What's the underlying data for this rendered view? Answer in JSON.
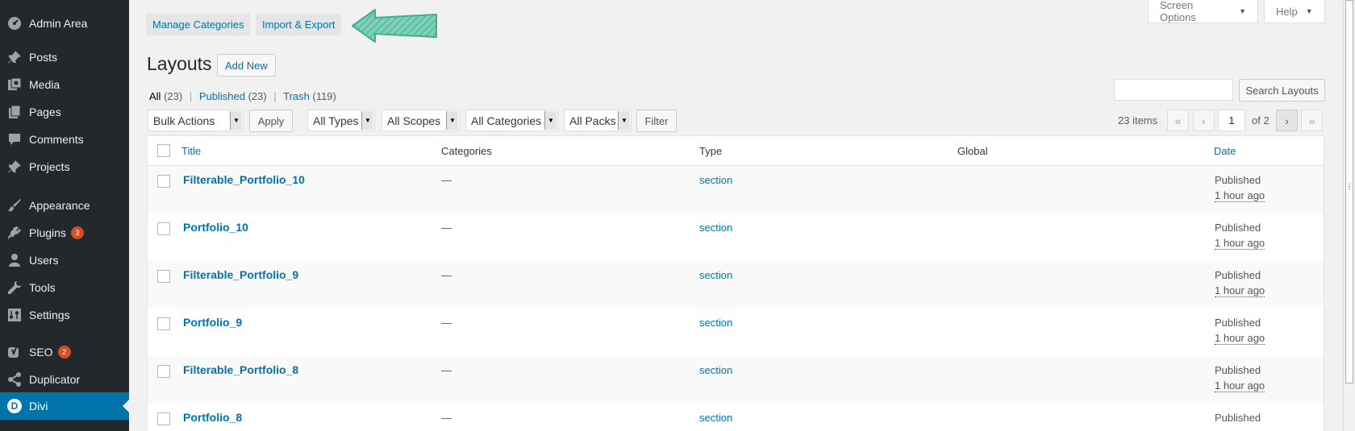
{
  "sidebar": {
    "items": [
      {
        "label": "Admin Area",
        "icon": "dashboard-icon"
      },
      {
        "label": "Posts",
        "icon": "pin-icon"
      },
      {
        "label": "Media",
        "icon": "media-icon"
      },
      {
        "label": "Pages",
        "icon": "pages-icon"
      },
      {
        "label": "Comments",
        "icon": "comment-icon"
      },
      {
        "label": "Projects",
        "icon": "pin-icon"
      },
      {
        "label": "Appearance",
        "icon": "brush-icon"
      },
      {
        "label": "Plugins",
        "icon": "plug-icon",
        "badge": "3"
      },
      {
        "label": "Users",
        "icon": "user-icon"
      },
      {
        "label": "Tools",
        "icon": "wrench-icon"
      },
      {
        "label": "Settings",
        "icon": "settings-icon"
      },
      {
        "label": "SEO",
        "icon": "yoast-icon",
        "badge": "2"
      },
      {
        "label": "Duplicator",
        "icon": "share-icon"
      },
      {
        "label": "Divi",
        "icon": "divi-logo-icon",
        "active": true
      }
    ]
  },
  "top_tabs": {
    "manage_categories": "Manage Categories",
    "import_export": "Import & Export"
  },
  "screen_meta": {
    "screen_options": "Screen Options",
    "help": "Help"
  },
  "page": {
    "title": "Layouts",
    "add_new": "Add New"
  },
  "views": {
    "all": {
      "label": "All",
      "count": "(23)"
    },
    "published": {
      "label": "Published",
      "count": "(23)"
    },
    "trash": {
      "label": "Trash",
      "count": "(119)"
    },
    "separator": "|"
  },
  "search": {
    "button": "Search Layouts",
    "value": ""
  },
  "filters": {
    "bulk_actions": "Bulk Actions",
    "apply": "Apply",
    "all_types": "All Types",
    "all_scopes": "All Scopes",
    "all_categories": "All Categories",
    "all_packs": "All Packs",
    "filter": "Filter"
  },
  "pagination": {
    "items": "23 items",
    "first": "«",
    "prev": "‹",
    "current": "1",
    "of": "of 2",
    "next": "›",
    "last": "»"
  },
  "table": {
    "headers": {
      "title": "Title",
      "categories": "Categories",
      "type": "Type",
      "global": "Global",
      "date": "Date"
    },
    "rows": [
      {
        "title": "Filterable_Portfolio_10",
        "categories": "—",
        "type": "section",
        "global": "",
        "status": "Published",
        "time": "1 hour ago"
      },
      {
        "title": "Portfolio_10",
        "categories": "—",
        "type": "section",
        "global": "",
        "status": "Published",
        "time": "1 hour ago"
      },
      {
        "title": "Filterable_Portfolio_9",
        "categories": "—",
        "type": "section",
        "global": "",
        "status": "Published",
        "time": "1 hour ago"
      },
      {
        "title": "Portfolio_9",
        "categories": "—",
        "type": "section",
        "global": "",
        "status": "Published",
        "time": "1 hour ago"
      },
      {
        "title": "Filterable_Portfolio_8",
        "categories": "—",
        "type": "section",
        "global": "",
        "status": "Published",
        "time": "1 hour ago"
      },
      {
        "title": "Portfolio_8",
        "categories": "—",
        "type": "section",
        "global": "",
        "status": "Published",
        "time": ""
      }
    ]
  },
  "colors": {
    "sidebar_bg": "#23282d",
    "active_bg": "#0073aa",
    "link": "#0073aa",
    "badge": "#d54e21",
    "arrow": "#4cb99b"
  }
}
